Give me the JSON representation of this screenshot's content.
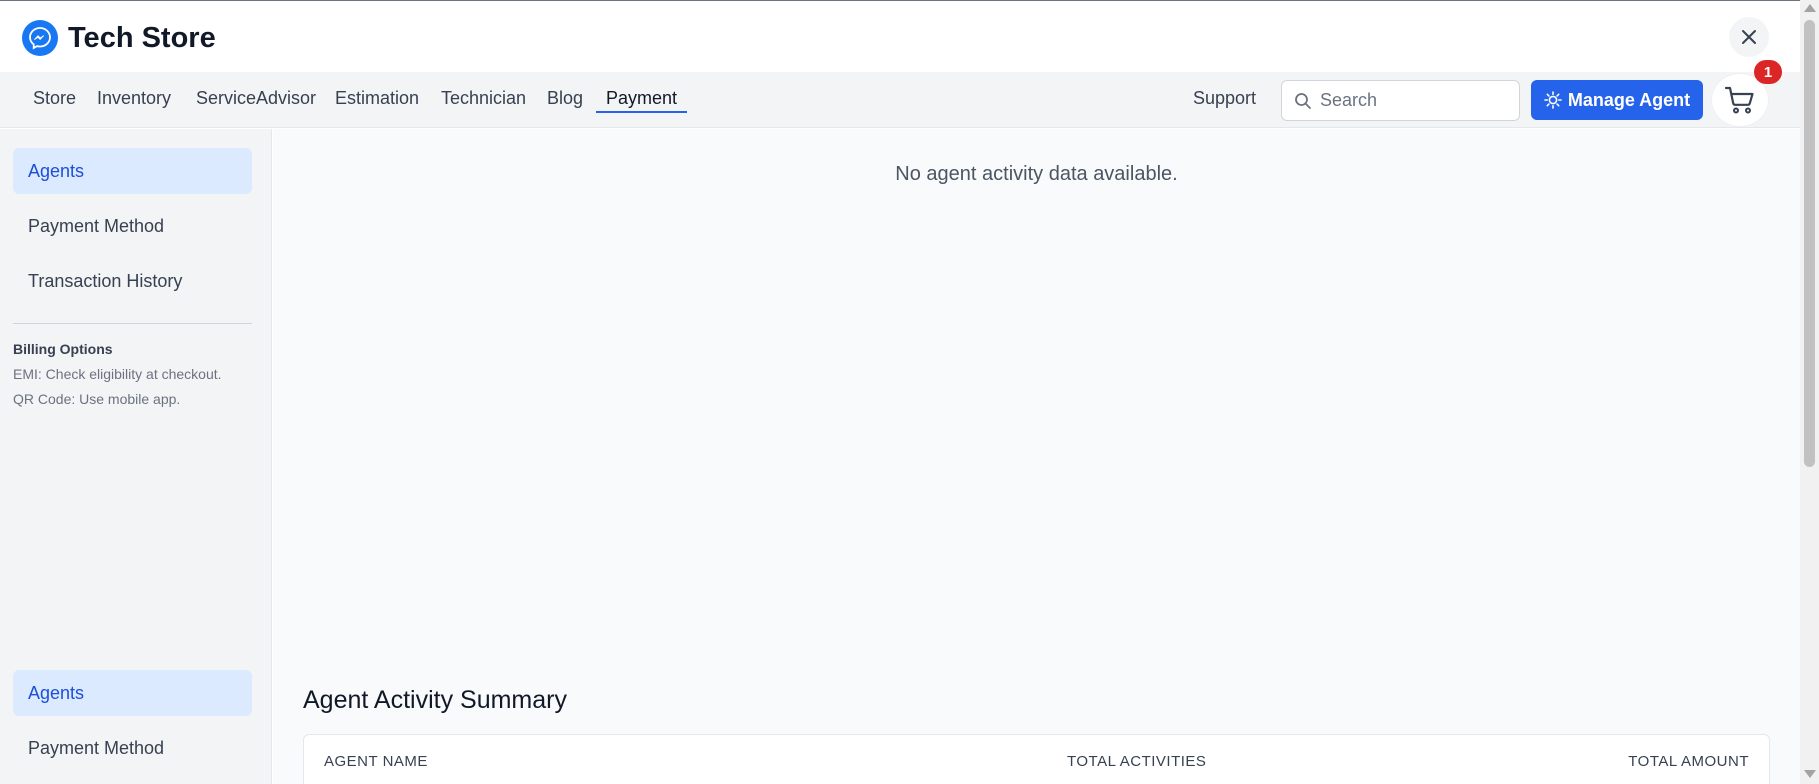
{
  "header": {
    "brand_title": "Tech Store",
    "logo_icon": "messenger-icon",
    "close_icon": "close-icon"
  },
  "nav": {
    "items": [
      {
        "label": "Store"
      },
      {
        "label": "Inventory"
      },
      {
        "label": "ServiceAdvisor"
      },
      {
        "label": "Estimation"
      },
      {
        "label": "Technician"
      },
      {
        "label": "Blog"
      },
      {
        "label": "Payment",
        "active": true
      }
    ],
    "support_label": "Support",
    "search_placeholder": "Search",
    "manage_agent_label": "Manage Agent",
    "cart_count": "1"
  },
  "sidebar": {
    "items": [
      {
        "label": "Agents",
        "active": true
      },
      {
        "label": "Payment Method"
      },
      {
        "label": "Transaction History"
      }
    ],
    "billing": {
      "title": "Billing Options",
      "lines": [
        "EMI: Check eligibility at checkout.",
        "QR Code: Use mobile app."
      ]
    },
    "bottom_items": [
      {
        "label": "Agents",
        "active": true
      },
      {
        "label": "Payment Method"
      }
    ]
  },
  "main": {
    "empty_message": "No agent activity data available.",
    "summary_title": "Agent Activity Summary",
    "table_headers": [
      "AGENT NAME",
      "TOTAL ACTIVITIES",
      "TOTAL AMOUNT"
    ]
  },
  "colors": {
    "accent": "#2563eb",
    "badge": "#dc2626",
    "active_bg": "#dbeafe",
    "logo": "#1877f2"
  }
}
